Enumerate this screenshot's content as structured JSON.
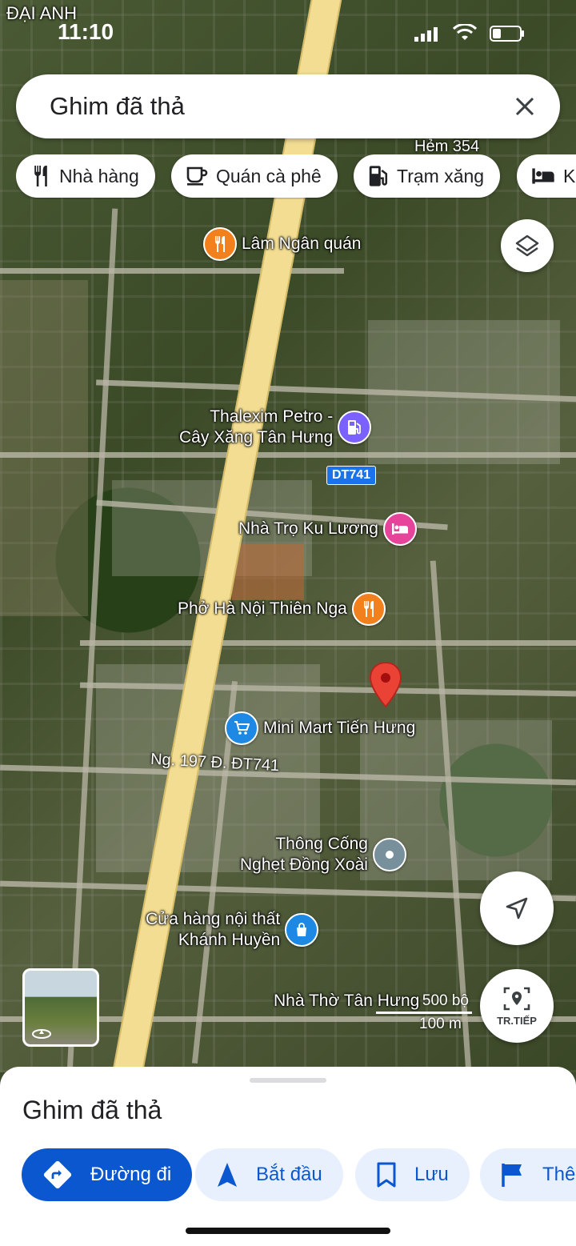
{
  "status_bar": {
    "time": "11:10"
  },
  "search": {
    "value": "Ghim đã thả"
  },
  "chips": [
    {
      "label": "Nhà hàng",
      "icon": "restaurant-icon"
    },
    {
      "label": "Quán cà phê",
      "icon": "coffee-icon"
    },
    {
      "label": "Trạm xăng",
      "icon": "gas-station-icon"
    },
    {
      "label": "Khách sạn",
      "icon": "hotel-icon"
    }
  ],
  "map": {
    "pois": [
      {
        "name": "Lâm Ngân quán",
        "type": "restaurant"
      },
      {
        "name": "Thalexim Petro - Cây Xăng Tân Hưng",
        "line1": "Thalexim Petro -",
        "line2": "Cây Xăng Tân Hưng",
        "type": "gas"
      },
      {
        "name": "Nhà Trọ Ku Lương",
        "type": "lodging"
      },
      {
        "name": "Phở Hà Nội Thiên Nga",
        "type": "restaurant"
      },
      {
        "name": "Mini Mart Tiến Hưng",
        "type": "shopping"
      },
      {
        "name": "Thông Cống Nghẹt Đồng Xoài",
        "line1": "Thông Cống",
        "line2": "Nghẹt Đồng Xoài",
        "type": "place"
      },
      {
        "name": "Cửa hàng nội thất Khánh Huyền",
        "line1": "Cửa hàng nội thất",
        "line2": "Khánh Huyền",
        "type": "store"
      },
      {
        "name": "Nhà Thờ Tân Hưng",
        "type": "church"
      }
    ],
    "road_labels": {
      "side_road": "Ng. 197 Đ. ĐT741",
      "alley": "Hẻm 354",
      "top_left": "ĐẠI ANH"
    },
    "shield": "DT741",
    "scale": {
      "feet": "500 bộ",
      "meters": "100 m"
    },
    "colors": {
      "pin": "#ea4335",
      "restaurant": "#f2811d",
      "gas": "#7b61ff",
      "lodging": "#e6449a",
      "shopping": "#1e88e5"
    }
  },
  "fabs": {
    "layers": "layers-icon",
    "location": "my-location-icon",
    "explore_label": "TR.TIẾP"
  },
  "sheet": {
    "title": "Ghim đã thả",
    "actions": [
      {
        "label": "Đường đi",
        "icon": "directions-icon"
      },
      {
        "label": "Bắt đầu",
        "icon": "navigation-icon"
      },
      {
        "label": "Lưu",
        "icon": "bookmark-icon"
      },
      {
        "label": "Thêm nhãn",
        "icon": "flag-icon"
      }
    ]
  }
}
